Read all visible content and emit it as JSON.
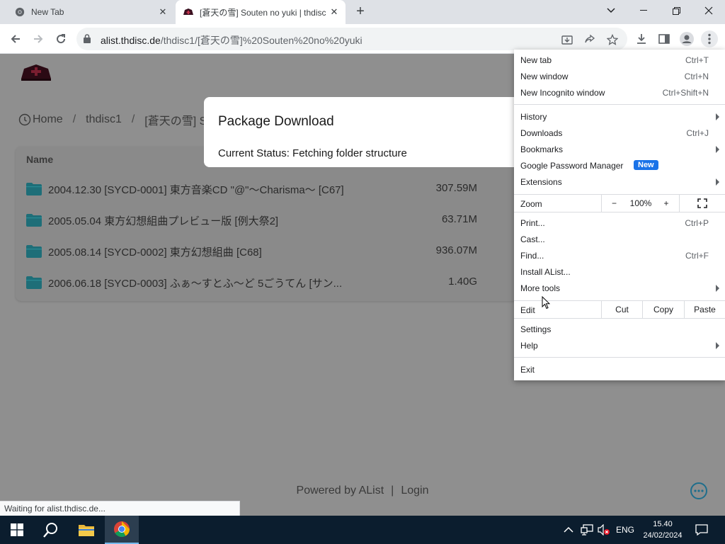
{
  "browser": {
    "tabs": [
      {
        "title": "New Tab",
        "active": false
      },
      {
        "title": "[蒼天の雪] Souten no yuki | thdisc",
        "active": true
      }
    ],
    "url": {
      "host": "alist.thdisc.de",
      "path": "/thdisc1/[蒼天の雪]%20Souten%20no%20yuki"
    },
    "status_text": "Waiting for alist.thdisc.de..."
  },
  "page": {
    "breadcrumb": {
      "home": "Home",
      "folder1": "thdisc1",
      "folder2": "[蒼天の雪] So"
    },
    "list_header": "Name",
    "files": [
      {
        "name": "2004.12.30 [SYCD-0001] 東方音楽CD \"@\"～Charisma～ [C67]",
        "size": "307.59M"
      },
      {
        "name": "2005.05.04 東方幻想組曲プレビュー版 [例大祭2]",
        "size": "63.71M"
      },
      {
        "name": "2005.08.14 [SYCD-0002] 東方幻想組曲 [C68]",
        "size": "936.07M"
      },
      {
        "name": "2006.06.18 [SYCD-0003] ふぁ～すとふ～ど 5ごうてん [サン...",
        "size": "1.40G"
      }
    ],
    "footer": {
      "powered": "Powered by AList",
      "sep": "|",
      "login": "Login"
    }
  },
  "modal": {
    "title": "Package Download",
    "status": "Current Status: Fetching folder structure"
  },
  "menu": {
    "new_tab": {
      "label": "New tab",
      "shortcut": "Ctrl+T"
    },
    "new_window": {
      "label": "New window",
      "shortcut": "Ctrl+N"
    },
    "incognito": {
      "label": "New Incognito window",
      "shortcut": "Ctrl+Shift+N"
    },
    "history": {
      "label": "History"
    },
    "downloads": {
      "label": "Downloads",
      "shortcut": "Ctrl+J"
    },
    "bookmarks": {
      "label": "Bookmarks"
    },
    "password_manager": {
      "label": "Google Password Manager",
      "badge": "New"
    },
    "extensions": {
      "label": "Extensions"
    },
    "zoom": {
      "label": "Zoom",
      "minus": "−",
      "level": "100%",
      "plus": "+"
    },
    "print": {
      "label": "Print...",
      "shortcut": "Ctrl+P"
    },
    "cast": {
      "label": "Cast..."
    },
    "find": {
      "label": "Find...",
      "shortcut": "Ctrl+F"
    },
    "install": {
      "label": "Install AList..."
    },
    "more_tools": {
      "label": "More tools"
    },
    "edit": {
      "label": "Edit",
      "cut": "Cut",
      "copy": "Copy",
      "paste": "Paste"
    },
    "settings": {
      "label": "Settings"
    },
    "help": {
      "label": "Help"
    },
    "exit": {
      "label": "Exit"
    }
  },
  "taskbar": {
    "lang": "ENG",
    "time": "15.40",
    "date": "24/02/2024"
  },
  "colors": {
    "modal_overlay": "#8f8f8f",
    "folder": "#1e6e78",
    "badge": "#1a73e8",
    "taskbar": "#0b1d2e"
  }
}
